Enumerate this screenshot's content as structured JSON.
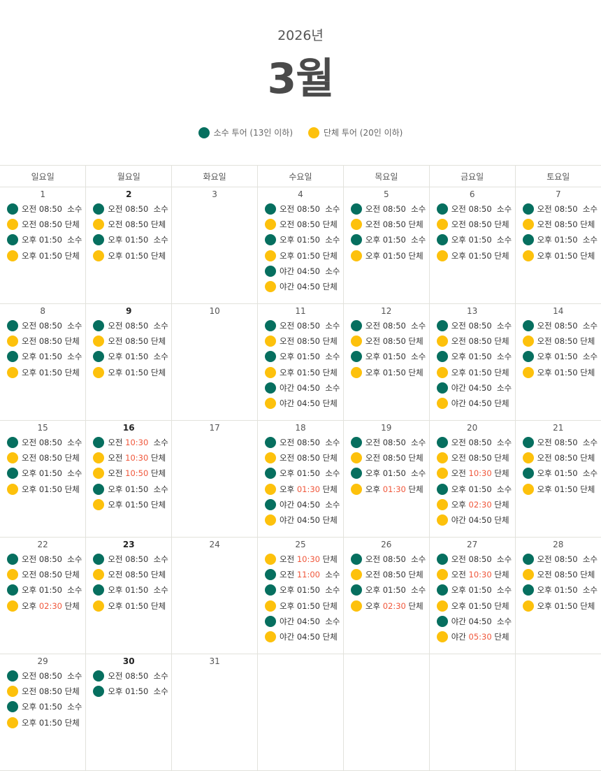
{
  "header": {
    "year": "2026년",
    "month": "3월"
  },
  "legend": [
    {
      "label": "소수 투어 (13인 이하)",
      "color": "#066f5f",
      "icon": "green-dot-icon"
    },
    {
      "label": "단체 투어 (20인 이하)",
      "color": "#fdc10c",
      "icon": "yellow-dot-icon"
    }
  ],
  "colors": {
    "small": "#066f5f",
    "group": "#fdc10c",
    "highlight": "#f0573b"
  },
  "weekdays": [
    "일요일",
    "월요일",
    "화요일",
    "수요일",
    "목요일",
    "금요일",
    "토요일"
  ],
  "weeks": [
    [
      {
        "day": "1",
        "bold": false,
        "slots": [
          {
            "t": "s",
            "p": "오전",
            "time": "08:50",
            "label": "소수"
          },
          {
            "t": "g",
            "p": "오전",
            "time": "08:50",
            "label": "단체"
          },
          {
            "t": "s",
            "p": "오후",
            "time": "01:50",
            "label": "소수"
          },
          {
            "t": "g",
            "p": "오후",
            "time": "01:50",
            "label": "단체"
          }
        ]
      },
      {
        "day": "2",
        "bold": true,
        "slots": [
          {
            "t": "s",
            "p": "오전",
            "time": "08:50",
            "label": "소수"
          },
          {
            "t": "g",
            "p": "오전",
            "time": "08:50",
            "label": "단체"
          },
          {
            "t": "s",
            "p": "오후",
            "time": "01:50",
            "label": "소수"
          },
          {
            "t": "g",
            "p": "오후",
            "time": "01:50",
            "label": "단체"
          }
        ]
      },
      {
        "day": "3",
        "bold": false,
        "slots": []
      },
      {
        "day": "4",
        "bold": false,
        "slots": [
          {
            "t": "s",
            "p": "오전",
            "time": "08:50",
            "label": "소수"
          },
          {
            "t": "g",
            "p": "오전",
            "time": "08:50",
            "label": "단체"
          },
          {
            "t": "s",
            "p": "오후",
            "time": "01:50",
            "label": "소수"
          },
          {
            "t": "g",
            "p": "오후",
            "time": "01:50",
            "label": "단체"
          },
          {
            "t": "s",
            "p": "야간",
            "time": "04:50",
            "label": "소수"
          },
          {
            "t": "g",
            "p": "야간",
            "time": "04:50",
            "label": "단체"
          }
        ]
      },
      {
        "day": "5",
        "bold": false,
        "slots": [
          {
            "t": "s",
            "p": "오전",
            "time": "08:50",
            "label": "소수"
          },
          {
            "t": "g",
            "p": "오전",
            "time": "08:50",
            "label": "단체"
          },
          {
            "t": "s",
            "p": "오후",
            "time": "01:50",
            "label": "소수"
          },
          {
            "t": "g",
            "p": "오후",
            "time": "01:50",
            "label": "단체"
          }
        ]
      },
      {
        "day": "6",
        "bold": false,
        "slots": [
          {
            "t": "s",
            "p": "오전",
            "time": "08:50",
            "label": "소수"
          },
          {
            "t": "g",
            "p": "오전",
            "time": "08:50",
            "label": "단체"
          },
          {
            "t": "s",
            "p": "오후",
            "time": "01:50",
            "label": "소수"
          },
          {
            "t": "g",
            "p": "오후",
            "time": "01:50",
            "label": "단체"
          }
        ]
      },
      {
        "day": "7",
        "bold": false,
        "slots": [
          {
            "t": "s",
            "p": "오전",
            "time": "08:50",
            "label": "소수"
          },
          {
            "t": "g",
            "p": "오전",
            "time": "08:50",
            "label": "단체"
          },
          {
            "t": "s",
            "p": "오후",
            "time": "01:50",
            "label": "소수"
          },
          {
            "t": "g",
            "p": "오후",
            "time": "01:50",
            "label": "단체"
          }
        ]
      }
    ],
    [
      {
        "day": "8",
        "bold": false,
        "slots": [
          {
            "t": "s",
            "p": "오전",
            "time": "08:50",
            "label": "소수"
          },
          {
            "t": "g",
            "p": "오전",
            "time": "08:50",
            "label": "단체"
          },
          {
            "t": "s",
            "p": "오후",
            "time": "01:50",
            "label": "소수"
          },
          {
            "t": "g",
            "p": "오후",
            "time": "01:50",
            "label": "단체"
          }
        ]
      },
      {
        "day": "9",
        "bold": true,
        "slots": [
          {
            "t": "s",
            "p": "오전",
            "time": "08:50",
            "label": "소수"
          },
          {
            "t": "g",
            "p": "오전",
            "time": "08:50",
            "label": "단체"
          },
          {
            "t": "s",
            "p": "오후",
            "time": "01:50",
            "label": "소수"
          },
          {
            "t": "g",
            "p": "오후",
            "time": "01:50",
            "label": "단체"
          }
        ]
      },
      {
        "day": "10",
        "bold": false,
        "slots": []
      },
      {
        "day": "11",
        "bold": false,
        "slots": [
          {
            "t": "s",
            "p": "오전",
            "time": "08:50",
            "label": "소수"
          },
          {
            "t": "g",
            "p": "오전",
            "time": "08:50",
            "label": "단체"
          },
          {
            "t": "s",
            "p": "오후",
            "time": "01:50",
            "label": "소수"
          },
          {
            "t": "g",
            "p": "오후",
            "time": "01:50",
            "label": "단체"
          },
          {
            "t": "s",
            "p": "야간",
            "time": "04:50",
            "label": "소수"
          },
          {
            "t": "g",
            "p": "야간",
            "time": "04:50",
            "label": "단체"
          }
        ]
      },
      {
        "day": "12",
        "bold": false,
        "slots": [
          {
            "t": "s",
            "p": "오전",
            "time": "08:50",
            "label": "소수"
          },
          {
            "t": "g",
            "p": "오전",
            "time": "08:50",
            "label": "단체"
          },
          {
            "t": "s",
            "p": "오후",
            "time": "01:50",
            "label": "소수"
          },
          {
            "t": "g",
            "p": "오후",
            "time": "01:50",
            "label": "단체"
          }
        ]
      },
      {
        "day": "13",
        "bold": false,
        "slots": [
          {
            "t": "s",
            "p": "오전",
            "time": "08:50",
            "label": "소수"
          },
          {
            "t": "g",
            "p": "오전",
            "time": "08:50",
            "label": "단체"
          },
          {
            "t": "s",
            "p": "오후",
            "time": "01:50",
            "label": "소수"
          },
          {
            "t": "g",
            "p": "오후",
            "time": "01:50",
            "label": "단체"
          },
          {
            "t": "s",
            "p": "야간",
            "time": "04:50",
            "label": "소수"
          },
          {
            "t": "g",
            "p": "야간",
            "time": "04:50",
            "label": "단체"
          }
        ]
      },
      {
        "day": "14",
        "bold": false,
        "slots": [
          {
            "t": "s",
            "p": "오전",
            "time": "08:50",
            "label": "소수"
          },
          {
            "t": "g",
            "p": "오전",
            "time": "08:50",
            "label": "단체"
          },
          {
            "t": "s",
            "p": "오후",
            "time": "01:50",
            "label": "소수"
          },
          {
            "t": "g",
            "p": "오후",
            "time": "01:50",
            "label": "단체"
          }
        ]
      }
    ],
    [
      {
        "day": "15",
        "bold": false,
        "slots": [
          {
            "t": "s",
            "p": "오전",
            "time": "08:50",
            "label": "소수"
          },
          {
            "t": "g",
            "p": "오전",
            "time": "08:50",
            "label": "단체"
          },
          {
            "t": "s",
            "p": "오후",
            "time": "01:50",
            "label": "소수"
          },
          {
            "t": "g",
            "p": "오후",
            "time": "01:50",
            "label": "단체"
          }
        ]
      },
      {
        "day": "16",
        "bold": true,
        "slots": [
          {
            "t": "s",
            "p": "오전",
            "time": "10:30",
            "label": "소수",
            "hl": true
          },
          {
            "t": "g",
            "p": "오전",
            "time": "10:30",
            "label": "단체",
            "hl": true
          },
          {
            "t": "g",
            "p": "오전",
            "time": "10:50",
            "label": "단체",
            "hl": true
          },
          {
            "t": "s",
            "p": "오후",
            "time": "01:50",
            "label": "소수"
          },
          {
            "t": "g",
            "p": "오후",
            "time": "01:50",
            "label": "단체"
          }
        ]
      },
      {
        "day": "17",
        "bold": false,
        "slots": []
      },
      {
        "day": "18",
        "bold": false,
        "slots": [
          {
            "t": "s",
            "p": "오전",
            "time": "08:50",
            "label": "소수"
          },
          {
            "t": "g",
            "p": "오전",
            "time": "08:50",
            "label": "단체"
          },
          {
            "t": "s",
            "p": "오후",
            "time": "01:50",
            "label": "소수"
          },
          {
            "t": "g",
            "p": "오후",
            "time": "01:30",
            "label": "단체",
            "hl": true
          },
          {
            "t": "s",
            "p": "야간",
            "time": "04:50",
            "label": "소수"
          },
          {
            "t": "g",
            "p": "야간",
            "time": "04:50",
            "label": "단체"
          }
        ]
      },
      {
        "day": "19",
        "bold": false,
        "slots": [
          {
            "t": "s",
            "p": "오전",
            "time": "08:50",
            "label": "소수"
          },
          {
            "t": "g",
            "p": "오전",
            "time": "08:50",
            "label": "단체"
          },
          {
            "t": "s",
            "p": "오후",
            "time": "01:50",
            "label": "소수"
          },
          {
            "t": "g",
            "p": "오후",
            "time": "01:30",
            "label": "단체",
            "hl": true
          }
        ]
      },
      {
        "day": "20",
        "bold": false,
        "slots": [
          {
            "t": "s",
            "p": "오전",
            "time": "08:50",
            "label": "소수"
          },
          {
            "t": "g",
            "p": "오전",
            "time": "08:50",
            "label": "단체"
          },
          {
            "t": "g",
            "p": "오전",
            "time": "10:30",
            "label": "단체",
            "hl": true
          },
          {
            "t": "s",
            "p": "오후",
            "time": "01:50",
            "label": "소수"
          },
          {
            "t": "g",
            "p": "오후",
            "time": "02:30",
            "label": "단체",
            "hl": true
          },
          {
            "t": "g",
            "p": "야간",
            "time": "04:50",
            "label": "단체"
          }
        ]
      },
      {
        "day": "21",
        "bold": false,
        "slots": [
          {
            "t": "s",
            "p": "오전",
            "time": "08:50",
            "label": "소수"
          },
          {
            "t": "g",
            "p": "오전",
            "time": "08:50",
            "label": "단체"
          },
          {
            "t": "s",
            "p": "오후",
            "time": "01:50",
            "label": "소수"
          },
          {
            "t": "g",
            "p": "오후",
            "time": "01:50",
            "label": "단체"
          }
        ]
      }
    ],
    [
      {
        "day": "22",
        "bold": false,
        "slots": [
          {
            "t": "s",
            "p": "오전",
            "time": "08:50",
            "label": "소수"
          },
          {
            "t": "g",
            "p": "오전",
            "time": "08:50",
            "label": "단체"
          },
          {
            "t": "s",
            "p": "오후",
            "time": "01:50",
            "label": "소수"
          },
          {
            "t": "g",
            "p": "오후",
            "time": "02:30",
            "label": "단체",
            "hl": true
          }
        ]
      },
      {
        "day": "23",
        "bold": true,
        "slots": [
          {
            "t": "s",
            "p": "오전",
            "time": "08:50",
            "label": "소수"
          },
          {
            "t": "g",
            "p": "오전",
            "time": "08:50",
            "label": "단체"
          },
          {
            "t": "s",
            "p": "오후",
            "time": "01:50",
            "label": "소수"
          },
          {
            "t": "g",
            "p": "오후",
            "time": "01:50",
            "label": "단체"
          }
        ]
      },
      {
        "day": "24",
        "bold": false,
        "slots": []
      },
      {
        "day": "25",
        "bold": false,
        "slots": [
          {
            "t": "g",
            "p": "오전",
            "time": "10:30",
            "label": "단체",
            "hl": true
          },
          {
            "t": "s",
            "p": "오전",
            "time": "11:00",
            "label": "소수",
            "hl": true
          },
          {
            "t": "s",
            "p": "오후",
            "time": "01:50",
            "label": "소수"
          },
          {
            "t": "g",
            "p": "오후",
            "time": "01:50",
            "label": "단체"
          },
          {
            "t": "s",
            "p": "야간",
            "time": "04:50",
            "label": "소수"
          },
          {
            "t": "g",
            "p": "야간",
            "time": "04:50",
            "label": "단체"
          }
        ]
      },
      {
        "day": "26",
        "bold": false,
        "slots": [
          {
            "t": "s",
            "p": "오전",
            "time": "08:50",
            "label": "소수"
          },
          {
            "t": "g",
            "p": "오전",
            "time": "08:50",
            "label": "단체"
          },
          {
            "t": "s",
            "p": "오후",
            "time": "01:50",
            "label": "소수"
          },
          {
            "t": "g",
            "p": "오후",
            "time": "02:30",
            "label": "단체",
            "hl": true
          }
        ]
      },
      {
        "day": "27",
        "bold": false,
        "slots": [
          {
            "t": "s",
            "p": "오전",
            "time": "08:50",
            "label": "소수"
          },
          {
            "t": "g",
            "p": "오전",
            "time": "10:30",
            "label": "단체",
            "hl": true
          },
          {
            "t": "s",
            "p": "오후",
            "time": "01:50",
            "label": "소수"
          },
          {
            "t": "g",
            "p": "오후",
            "time": "01:50",
            "label": "단체"
          },
          {
            "t": "s",
            "p": "야간",
            "time": "04:50",
            "label": "소수"
          },
          {
            "t": "g",
            "p": "야간",
            "time": "05:30",
            "label": "단체",
            "hl": true
          }
        ]
      },
      {
        "day": "28",
        "bold": false,
        "slots": [
          {
            "t": "s",
            "p": "오전",
            "time": "08:50",
            "label": "소수"
          },
          {
            "t": "g",
            "p": "오전",
            "time": "08:50",
            "label": "단체"
          },
          {
            "t": "s",
            "p": "오후",
            "time": "01:50",
            "label": "소수"
          },
          {
            "t": "g",
            "p": "오후",
            "time": "01:50",
            "label": "단체"
          }
        ]
      }
    ],
    [
      {
        "day": "29",
        "bold": false,
        "slots": [
          {
            "t": "s",
            "p": "오전",
            "time": "08:50",
            "label": "소수"
          },
          {
            "t": "g",
            "p": "오전",
            "time": "08:50",
            "label": "단체"
          },
          {
            "t": "s",
            "p": "오후",
            "time": "01:50",
            "label": "소수"
          },
          {
            "t": "g",
            "p": "오후",
            "time": "01:50",
            "label": "단체"
          }
        ]
      },
      {
        "day": "30",
        "bold": true,
        "slots": [
          {
            "t": "s",
            "p": "오전",
            "time": "08:50",
            "label": "소수"
          },
          {
            "t": "s",
            "p": "오후",
            "time": "01:50",
            "label": "소수"
          }
        ]
      },
      {
        "day": "31",
        "bold": false,
        "slots": []
      },
      {
        "day": "",
        "bold": false,
        "slots": []
      },
      {
        "day": "",
        "bold": false,
        "slots": []
      },
      {
        "day": "",
        "bold": false,
        "slots": []
      },
      {
        "day": "",
        "bold": false,
        "slots": []
      }
    ]
  ]
}
